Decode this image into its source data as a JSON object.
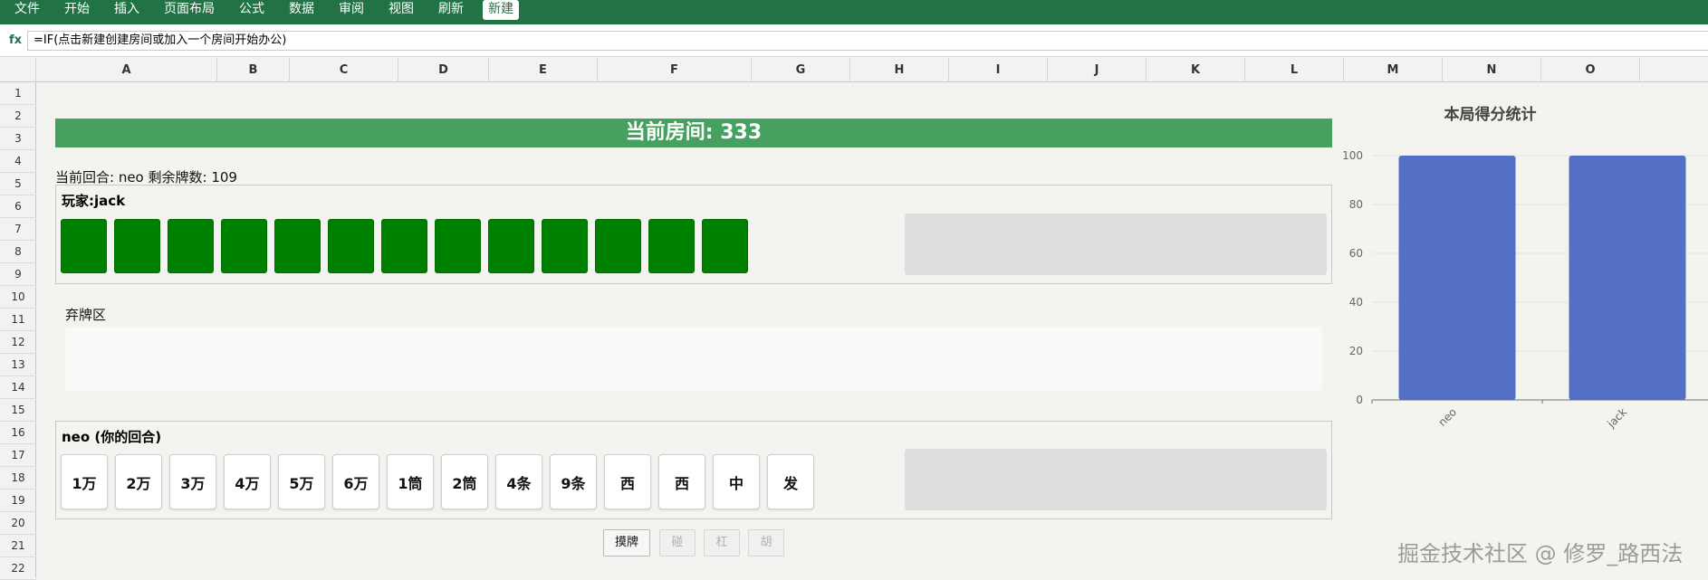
{
  "menu": {
    "items": [
      "文件",
      "开始",
      "插入",
      "页面布局",
      "公式",
      "数据",
      "审阅",
      "视图",
      "刷新",
      "新建"
    ]
  },
  "formula_bar": {
    "fx_label": "fx",
    "value": "=IF(点击新建创建房间或加入一个房间开始办公)"
  },
  "columns": [
    "A",
    "B",
    "C",
    "D",
    "E",
    "F",
    "G",
    "H",
    "I",
    "J",
    "K",
    "L",
    "M",
    "N",
    "O"
  ],
  "rows": [
    "1",
    "2",
    "3",
    "4",
    "5",
    "6",
    "7",
    "8",
    "9",
    "10",
    "11",
    "12",
    "13",
    "14",
    "15",
    "16",
    "17",
    "18",
    "19",
    "20",
    "21",
    "22"
  ],
  "game": {
    "room_title": "当前房间: 333",
    "status_line": "当前回合: neo 剩余牌数: 109",
    "opponent": {
      "label": "玩家:jack",
      "hidden_tile_count": 13
    },
    "discard_label": "弃牌区",
    "self": {
      "label": "neo (你的回合)",
      "hand": [
        "1万",
        "2万",
        "3万",
        "4万",
        "5万",
        "6万",
        "1筒",
        "2筒",
        "4条",
        "9条",
        "西",
        "西",
        "中",
        "发"
      ]
    },
    "buttons": [
      {
        "label": "摸牌",
        "enabled": true
      },
      {
        "label": "碰",
        "enabled": false
      },
      {
        "label": "杠",
        "enabled": false
      },
      {
        "label": "胡",
        "enabled": false
      }
    ]
  },
  "colors": {
    "brand": "#217346",
    "banner": "#46a160",
    "tile_back": "#008000",
    "bar": "#5470c6"
  },
  "chart_data": {
    "type": "bar",
    "title": "本局得分统计",
    "categories": [
      "neo",
      "jack"
    ],
    "values": [
      100,
      100
    ],
    "y_ticks": [
      "0",
      "20",
      "40",
      "60",
      "80",
      "100"
    ],
    "ylim": [
      0,
      100
    ],
    "grid": true
  },
  "watermark": "掘金技术社区 @ 修罗_路西法"
}
